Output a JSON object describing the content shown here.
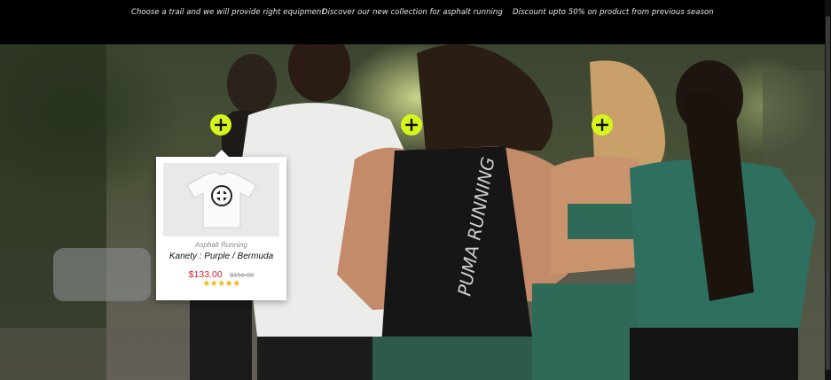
{
  "top_bar": {
    "promos": [
      "Choose a trail and we will provide right equipment",
      "Discover our new collection for asphalt running",
      "Discount upto 50% on product from previous season"
    ]
  },
  "hero": {
    "photo_text": "PUMA RUNNING",
    "hotspots": [
      "plus-icon",
      "plus-icon",
      "plus-icon"
    ],
    "accent_color": "#d6f51b"
  },
  "product_popup": {
    "category": "Asphalt Running",
    "name": "Kanety : Purple / Bermuda",
    "price": "$133.00",
    "old_price": "$150.00",
    "rating": 5,
    "stars": "★★★★★",
    "price_color": "#d1202f",
    "star_color": "#f2b60f"
  }
}
